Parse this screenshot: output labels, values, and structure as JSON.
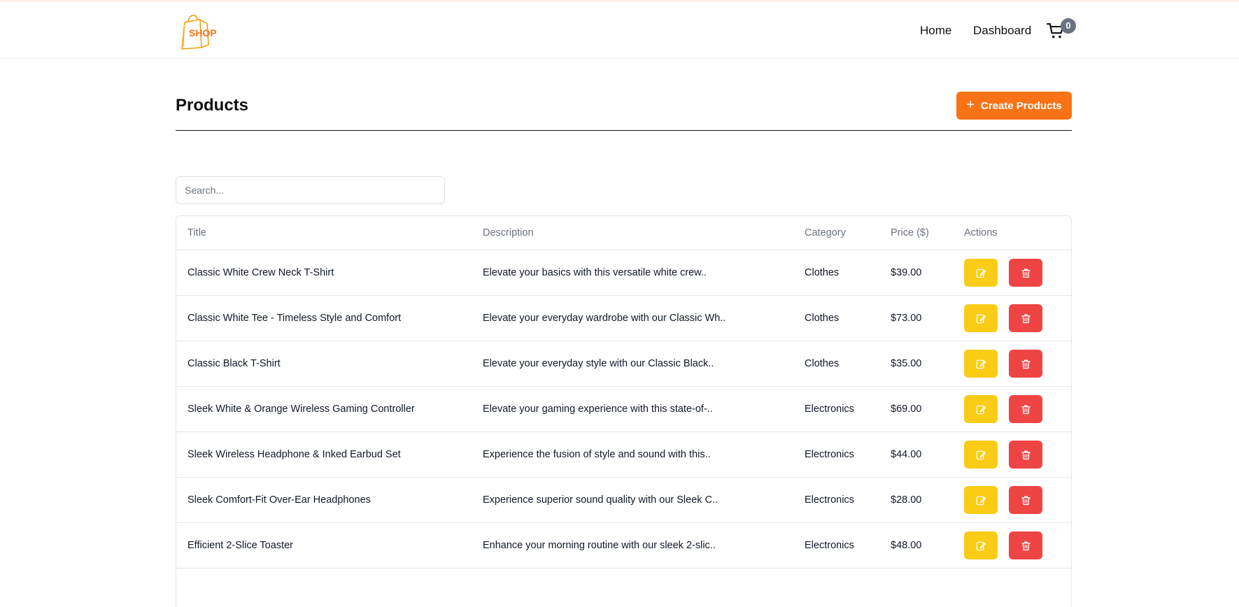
{
  "colors": {
    "accent": "#f97316",
    "edit": "#facc15",
    "delete": "#ef4444",
    "badge": "#6b7280"
  },
  "nav": {
    "logo_icon": "shopping-bag-logo",
    "logo_text": "SHOP",
    "home": "Home",
    "dashboard": "Dashboard",
    "cart_icon": "cart-icon",
    "cart_count": "0"
  },
  "page": {
    "title": "Products",
    "create_label": "Create Products",
    "create_icon": "plus-icon"
  },
  "search": {
    "placeholder": "Search...",
    "value": ""
  },
  "table": {
    "headers": {
      "title": "Title",
      "description": "Description",
      "category": "Category",
      "price": "Price ($)",
      "actions": "Actions"
    },
    "action_icons": {
      "edit": "edit-icon",
      "delete": "trash-icon"
    },
    "rows": [
      {
        "title": "Classic White Crew Neck T-Shirt",
        "description": "Elevate your basics with this versatile white crew..",
        "category": "Clothes",
        "price": "$39.00"
      },
      {
        "title": "Classic White Tee - Timeless Style and Comfort",
        "description": "Elevate your everyday wardrobe with our Classic Wh..",
        "category": "Clothes",
        "price": "$73.00"
      },
      {
        "title": "Classic Black T-Shirt",
        "description": "Elevate your everyday style with our Classic Black..",
        "category": "Clothes",
        "price": "$35.00"
      },
      {
        "title": "Sleek White & Orange Wireless Gaming Controller",
        "description": "Elevate your gaming experience with this state-of-..",
        "category": "Electronics",
        "price": "$69.00"
      },
      {
        "title": "Sleek Wireless Headphone & Inked Earbud Set",
        "description": "Experience the fusion of style and sound with this..",
        "category": "Electronics",
        "price": "$44.00"
      },
      {
        "title": "Sleek Comfort-Fit Over-Ear Headphones",
        "description": "Experience superior sound quality with our Sleek C..",
        "category": "Electronics",
        "price": "$28.00"
      },
      {
        "title": "Efficient 2-Slice Toaster",
        "description": "Enhance your morning routine with our sleek 2-slic..",
        "category": "Electronics",
        "price": "$48.00"
      }
    ]
  }
}
